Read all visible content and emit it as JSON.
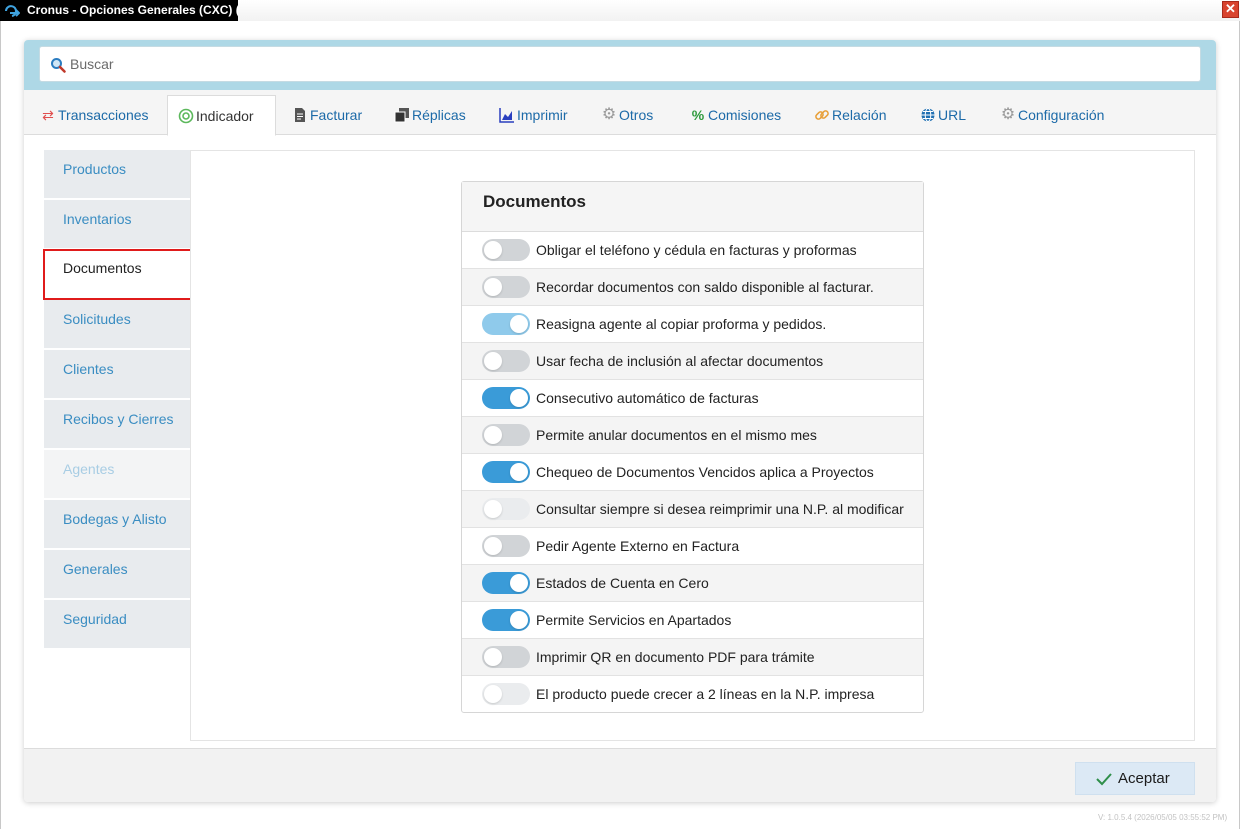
{
  "window": {
    "title": "Cronus - Opciones Generales (CXC) (B)",
    "close_label": "✕"
  },
  "search": {
    "placeholder": "Buscar",
    "value": ""
  },
  "tabs": [
    {
      "label": "Transacciones",
      "icon": "swap-arrows-icon",
      "color": "#e04f4f"
    },
    {
      "label": "Indicador",
      "icon": "target-icon",
      "color": "#5cb85c",
      "active": true
    },
    {
      "label": "Facturar",
      "icon": "document-icon",
      "color": "#555555"
    },
    {
      "label": "Réplicas",
      "icon": "copy-icon",
      "color": "#333333"
    },
    {
      "label": "Imprimir",
      "icon": "area-chart-icon",
      "color": "#2a3fbf"
    },
    {
      "label": "Otros",
      "icon": "gears-icon",
      "color": "#999999"
    },
    {
      "label": "Comisiones",
      "icon": "percent-icon",
      "color": "#2e9a3c"
    },
    {
      "label": "Relación",
      "icon": "link-icon",
      "color": "#e8a03a"
    },
    {
      "label": "URL",
      "icon": "globe-icon",
      "color": "#1f6fb2"
    },
    {
      "label": "Configuración",
      "icon": "gear-icon",
      "color": "#999999"
    }
  ],
  "sidebar": {
    "items": [
      {
        "label": "Productos"
      },
      {
        "label": "Inventarios"
      },
      {
        "label": "Documentos",
        "selected": true
      },
      {
        "label": "Solicitudes"
      },
      {
        "label": "Clientes"
      },
      {
        "label": "Recibos y Cierres"
      },
      {
        "label": "Agentes",
        "disabled": true
      },
      {
        "label": "Bodegas y Alisto"
      },
      {
        "label": "Generales"
      },
      {
        "label": "Seguridad"
      }
    ]
  },
  "documents": {
    "title": "Documentos",
    "options": [
      {
        "label": "Obligar el teléfono y cédula en facturas y proformas",
        "state": "off"
      },
      {
        "label": "Recordar documentos con saldo disponible al facturar.",
        "state": "off"
      },
      {
        "label": "Reasigna agente al copiar proforma y pedidos.",
        "state": "on-light"
      },
      {
        "label": "Usar fecha de inclusión al afectar documentos",
        "state": "off"
      },
      {
        "label": "Consecutivo automático de facturas",
        "state": "on"
      },
      {
        "label": "Permite anular documentos en el mismo mes",
        "state": "off"
      },
      {
        "label": "Chequeo de Documentos Vencidos aplica a Proyectos",
        "state": "on"
      },
      {
        "label": "Consultar siempre si desea reimprimir una N.P. al modificar",
        "state": "disabled"
      },
      {
        "label": "Pedir Agente Externo en Factura",
        "state": "off"
      },
      {
        "label": "Estados de Cuenta en Cero",
        "state": "on"
      },
      {
        "label": "Permite Servicios en Apartados",
        "state": "on"
      },
      {
        "label": "Imprimir QR en documento PDF para trámite",
        "state": "off"
      },
      {
        "label": "El producto puede crecer a 2 líneas en la N.P. impresa",
        "state": "disabled"
      }
    ]
  },
  "footer": {
    "accept_label": "Aceptar",
    "version": "V: 1.0.5.4 (2026/05/05 03:55:52 PM)"
  }
}
